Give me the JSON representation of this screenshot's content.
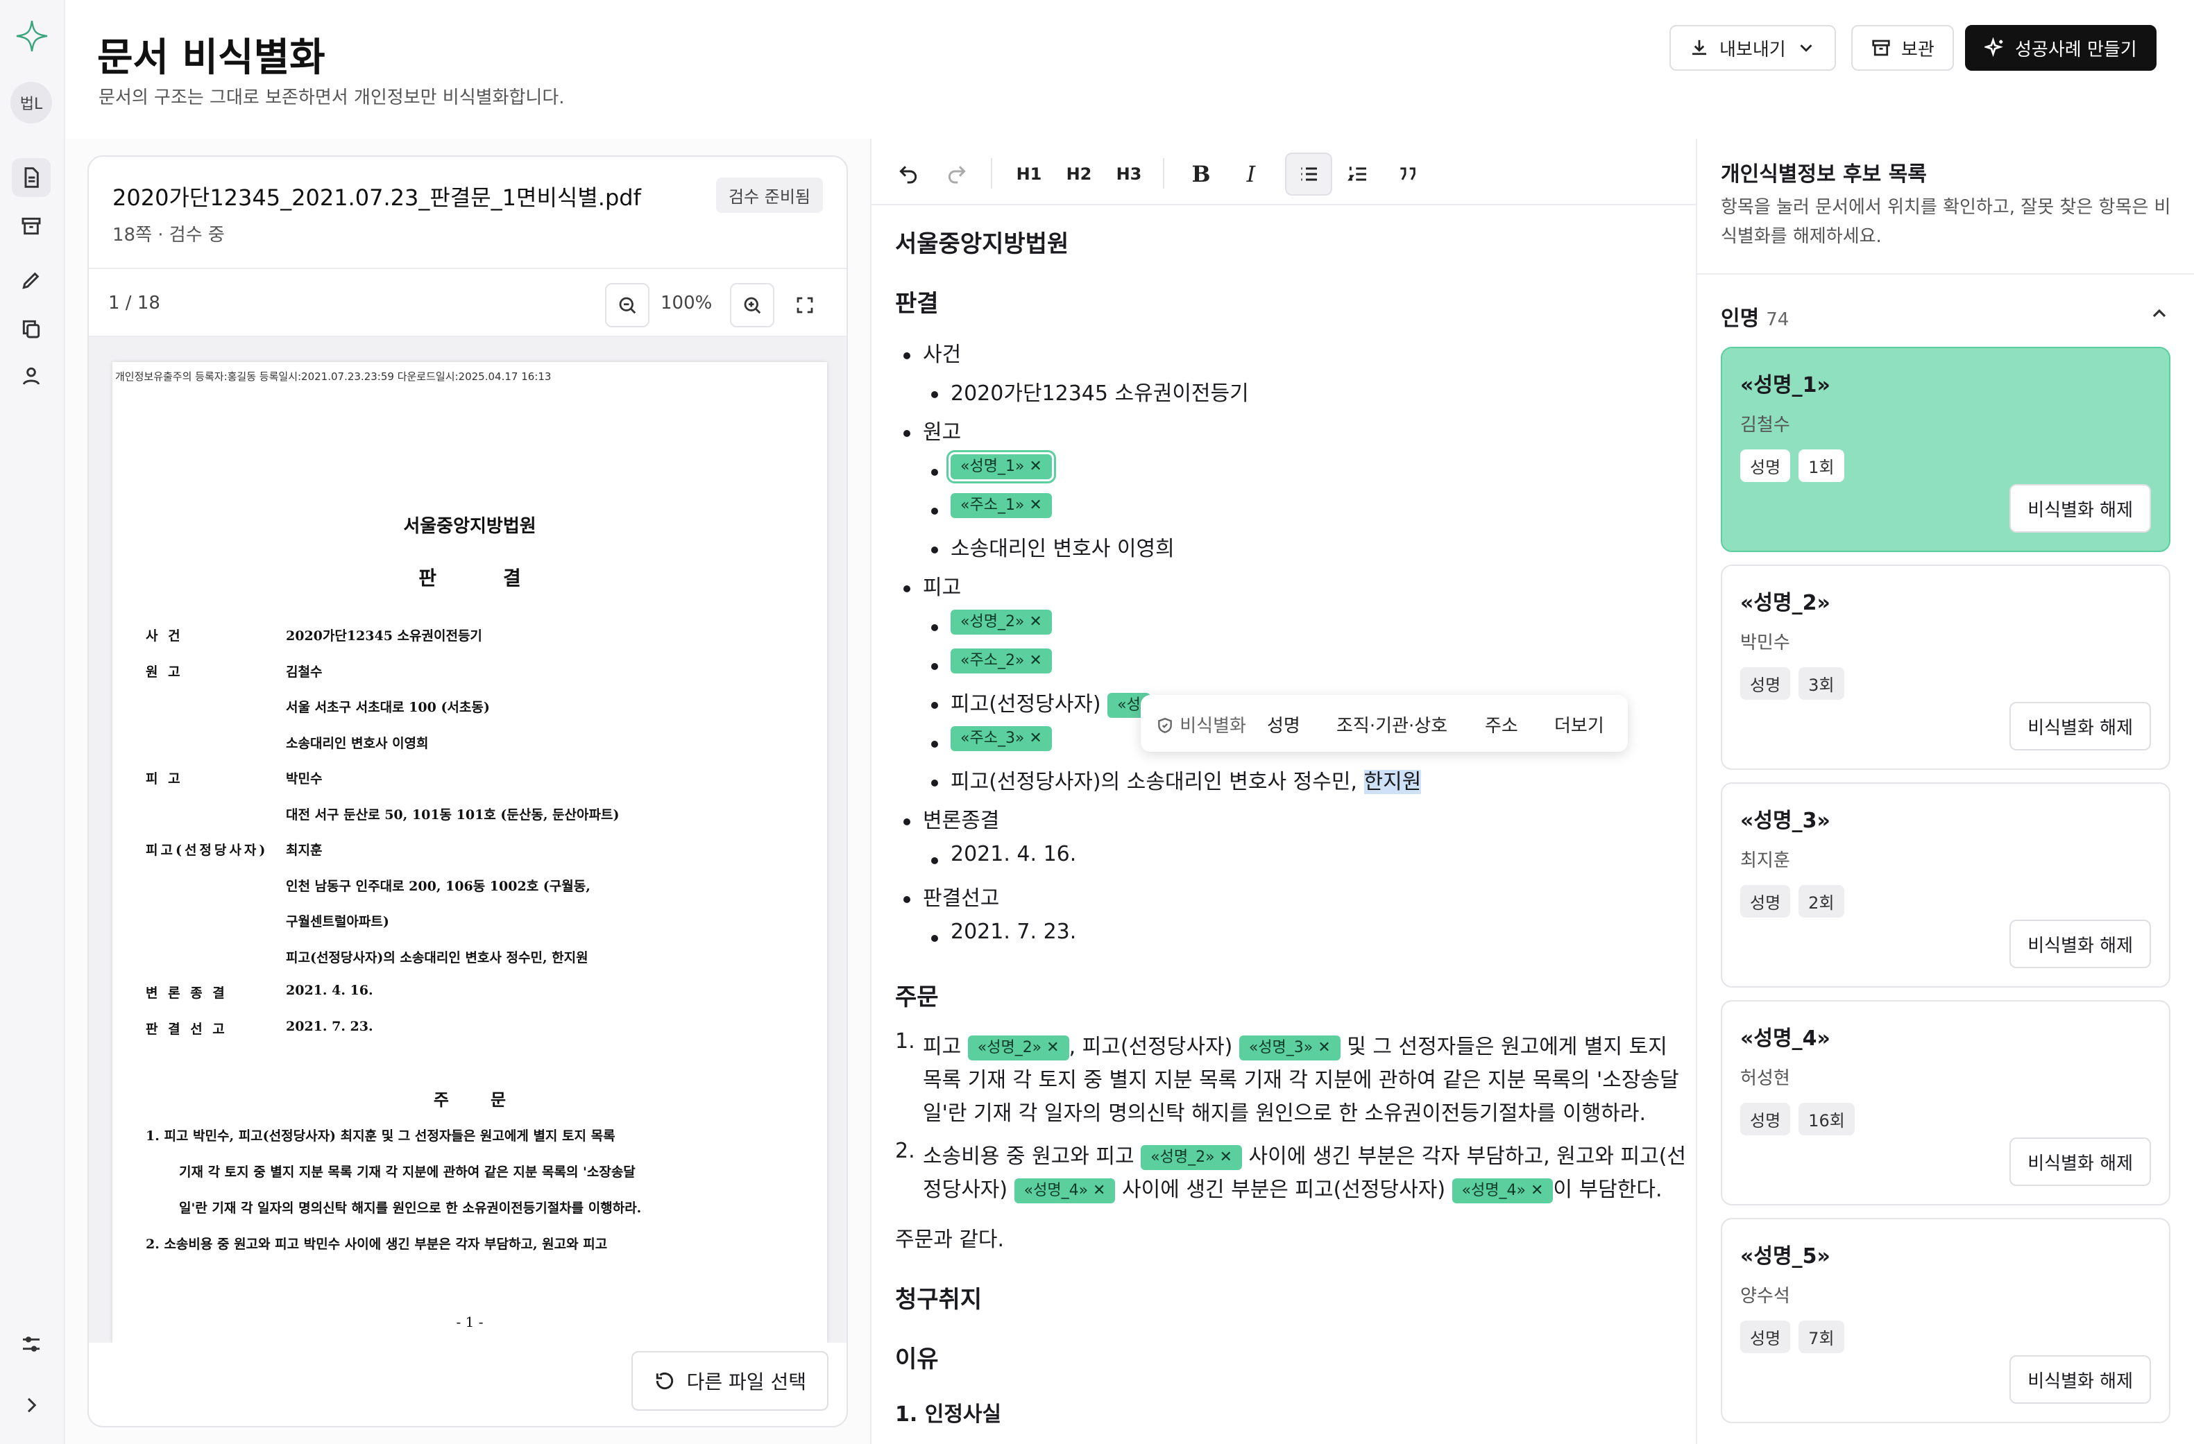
{
  "rail": {
    "avatar": "법L"
  },
  "header": {
    "title": "문서 비식별화",
    "subtitle": "문서의 구조는 그대로 보존하면서 개인정보만 비식별화합니다.",
    "export_label": "내보내기",
    "archive_label": "보관",
    "success_label": "성공사례 만들기"
  },
  "file": {
    "name": "2020가단12345_2021.07.23_판결문_1면비식별.pdf",
    "meta": "18쪽 · 검수 중",
    "badge": "검수 준비됨",
    "page": "1 / 18",
    "zoom": "100%",
    "other_file": "다른 파일 선택"
  },
  "pdf": {
    "header": "개인정보유출주의 등록자:홍길동 등록일시:2021.07.23.23:59 다운로드일시:2025.04.17 16:13",
    "court": "서울중앙지방법원",
    "judgment": "판결",
    "rows": [
      {
        "label": "사 건",
        "value": "2020가단12345 소유권이전등기"
      },
      {
        "label": "원 고",
        "value": "김철수"
      },
      {
        "label": "",
        "value": "서울 서초구 서초대로 100 (서초동)"
      },
      {
        "label": "",
        "value": "소송대리인 변호사 이영희"
      },
      {
        "label": "피 고",
        "value": "박민수"
      },
      {
        "label": "",
        "value": "대전 서구 둔산로 50, 101동 101호 (둔산동, 둔산아파트)"
      },
      {
        "label": "피고(선정당사자)",
        "value": "최지훈"
      },
      {
        "label": "",
        "value": "인천 남동구 인주대로 200, 106동 1002호 (구월동,"
      },
      {
        "label": "",
        "value": "구월센트럴아파트)"
      },
      {
        "label": "",
        "value": "피고(선정당사자)의 소송대리인 변호사 정수민, 한지원"
      },
      {
        "label": "변 론 종 결",
        "value": "2021. 4. 16."
      },
      {
        "label": "판 결 선 고",
        "value": "2021. 7. 23."
      }
    ],
    "order_title": "주문",
    "order_lines": [
      "1. 피고 박민수, 피고(선정당사자) 최지훈 및 그 선정자들은 원고에게 별지 토지 목록",
      "기재 각 토지 중 별지 지분 목록 기재 각 지분에 관하여 같은 지분 목록의 '소장송달",
      "일'란 기재 각 일자의 명의신탁 해지를 원인으로 한 소유권이전등기절차를 이행하라.",
      "2. 소송비용 중 원고와 피고 박민수 사이에 생긴 부분은 각자 부담하고, 원고와 피고"
    ],
    "page_num": "- 1 -"
  },
  "toolbar": {
    "h1": "H1",
    "h2": "H2",
    "h3": "H3",
    "bold": "B",
    "italic": "I"
  },
  "editor": {
    "court": "서울중앙지방법원",
    "judgment": "판결",
    "case": "사건",
    "case_value": "2020가단12345 소유권이전등기",
    "plaintiff": "원고",
    "chip_name1": "«성명_1»",
    "chip_addr1": "«주소_1»",
    "plaintiff_lawyer": "소송대리인 변호사 이영희",
    "defendant": "피고",
    "chip_name2": "«성명_2»",
    "chip_addr2": "«주소_2»",
    "def_party": "피고(선정당사자)",
    "chip_name3_partial": "«성",
    "chip_addr3": "«주소_3»",
    "def_lawyer_prefix": "피고(선정당사자)의 소송대리인 변호사 정수민, ",
    "def_lawyer_sel": "한지원",
    "closing": "변론종결",
    "closing_date": "2021. 4. 16.",
    "sentence": "판결선고",
    "sentence_date": "2021. 7. 23.",
    "order": "주문",
    "o1_a": "피고 ",
    "o1_chip1": "«성명_2»",
    "o1_b": ", 피고(선정당사자) ",
    "o1_chip2": "«성명_3»",
    "o1_c": " 및 그 선정자들은 원고에게 별지 토지",
    "o1_line2": "목록 기재 각 토지 중 별지 지분 목록 기재 각 지분에 관하여 같은 지분 목록의 '소장송달",
    "o1_line3": "일'란 기재 각 일자의 명의신탁 해지를 원인으로 한 소유권이전등기절차를 이행하라.",
    "o2_a": "소송비용 중 원고와 피고 ",
    "o2_chip1": "«성명_2»",
    "o2_b": " 사이에 생긴 부분은 각자 부담하고, 원고와 피고(선",
    "o2_c": "정당사자) ",
    "o2_chip2": "«성명_4»",
    "o2_d": " 사이에 생긴 부분은 피고(선정당사자) ",
    "o2_chip3": "«성명_4»",
    "o2_e": "이 부담한다.",
    "same": "주문과 같다.",
    "claim": "청구취지",
    "reason": "이유",
    "fact": "1. 인정사실",
    "num1": "1.",
    "num2": "2."
  },
  "popup": {
    "label": "비식별화",
    "name": "성명",
    "org": "조직·기관·상호",
    "addr": "주소",
    "more": "더보기"
  },
  "right": {
    "title": "개인식별정보 후보 목록",
    "desc": "항목을 눌러 문서에서 위치를 확인하고, 잘못 찾은 항목은 비식별화를 해제하세요.",
    "section": "인명",
    "count": "74",
    "cards": [
      {
        "token": "«성명_1»",
        "name": "김철수",
        "type": "성명",
        "freq": "1회",
        "button": "비식별화 해제"
      },
      {
        "token": "«성명_2»",
        "name": "박민수",
        "type": "성명",
        "freq": "3회",
        "button": "비식별화 해제"
      },
      {
        "token": "«성명_3»",
        "name": "최지훈",
        "type": "성명",
        "freq": "2회",
        "button": "비식별화 해제"
      },
      {
        "token": "«성명_4»",
        "name": "허성현",
        "type": "성명",
        "freq": "16회",
        "button": "비식별화 해제"
      },
      {
        "token": "«성명_5»",
        "name": "양수석",
        "type": "성명",
        "freq": "7회",
        "button": "비식별화 해제"
      }
    ]
  },
  "colors": {
    "accent": "#5ccf9f",
    "active_card": "#8ee0bf",
    "selection": "#cfe1f7"
  }
}
